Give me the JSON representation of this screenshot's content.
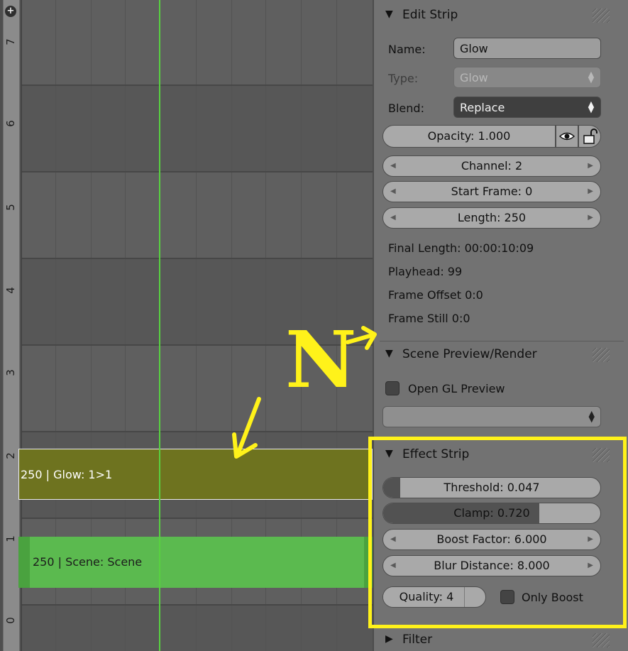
{
  "sequencer": {
    "channel_numbers": [
      "7",
      "6",
      "5",
      "4",
      "3",
      "2",
      "1",
      "0"
    ],
    "playhead_frame": "99",
    "strips": [
      {
        "label": "250 | Glow: 1>1",
        "type": "effect",
        "color": "#6e731f",
        "selected": true
      },
      {
        "label": "250 | Scene: Scene",
        "type": "scene",
        "color": "#5bba4f",
        "selected": false
      }
    ]
  },
  "panels": {
    "edit_strip": {
      "title": "Edit Strip",
      "name_label": "Name:",
      "name_value": "Glow",
      "type_label": "Type:",
      "type_value": "Glow",
      "blend_label": "Blend:",
      "blend_value": "Replace",
      "opacity": "Opacity: 1.000",
      "channel": "Channel: 2",
      "start_frame": "Start Frame: 0",
      "length": "Length: 250",
      "final_length": "Final Length: 00:00:10:09",
      "playhead": "Playhead: 99",
      "frame_offset": "Frame Offset 0:0",
      "frame_still": "Frame Still 0:0"
    },
    "scene_preview": {
      "title": "Scene Preview/Render",
      "opengl_preview_label": "Open GL Preview",
      "opengl_preview_checked": false
    },
    "effect_strip": {
      "title": "Effect Strip",
      "threshold": "Threshold: 0.047",
      "threshold_value": 0.047,
      "clamp": "Clamp: 0.720",
      "clamp_value": 0.72,
      "boost_factor": "Boost Factor: 6.000",
      "blur_distance": "Blur Distance: 8.000",
      "quality": "Quality: 4",
      "only_boost_label": "Only Boost",
      "only_boost_checked": false
    },
    "filter": {
      "title": "Filter"
    }
  },
  "annotation": {
    "letter": "N",
    "color": "#fff21a"
  }
}
